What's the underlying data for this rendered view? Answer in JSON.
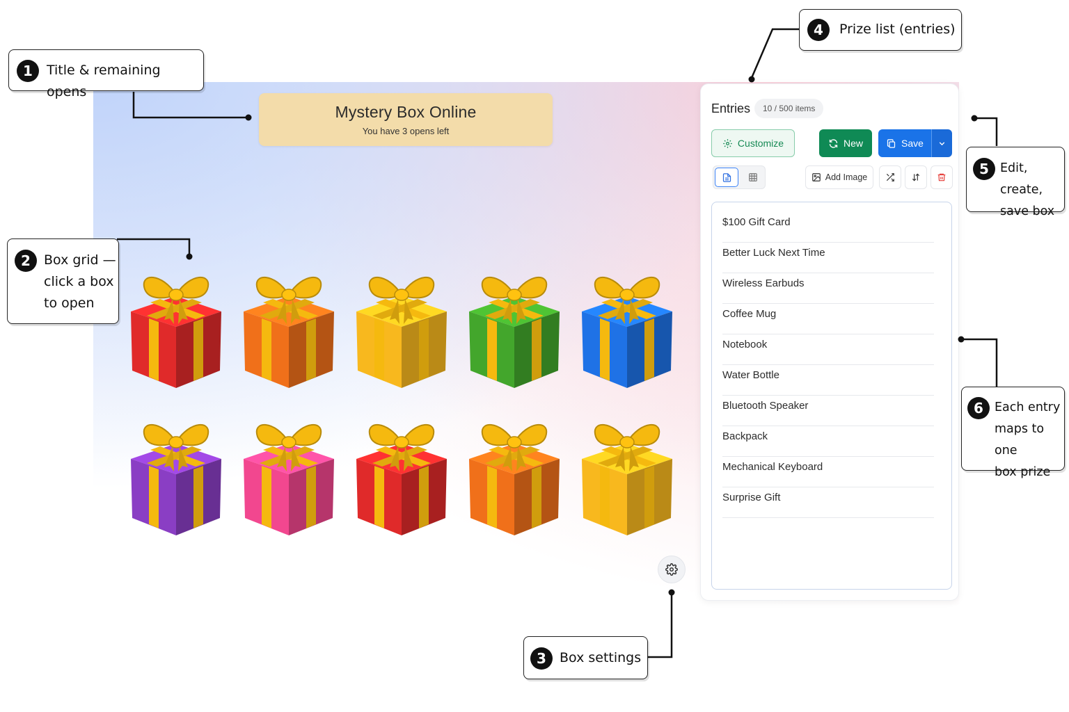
{
  "header": {
    "title": "Mystery Box Online",
    "subtitle": "You have 3 opens left"
  },
  "gift_boxes": [
    {
      "color": "#e02a2a"
    },
    {
      "color": "#f0701a"
    },
    {
      "color": "#f8b81e"
    },
    {
      "color": "#43a62c"
    },
    {
      "color": "#1f72e6"
    },
    {
      "color": "#8a3ec4"
    },
    {
      "color": "#f2478f"
    },
    {
      "color": "#e02a2a"
    },
    {
      "color": "#f0701a"
    },
    {
      "color": "#f8b81e"
    }
  ],
  "panel": {
    "title": "Entries",
    "count": "10 / 500 items",
    "customize_label": "Customize",
    "new_label": "New",
    "save_label": "Save",
    "add_image_label": "Add Image"
  },
  "entries": [
    "$100 Gift Card",
    "Better Luck Next Time",
    "Wireless Earbuds",
    "Coffee Mug",
    "Notebook",
    "Water Bottle",
    "Bluetooth Speaker",
    "Backpack",
    "Mechanical Keyboard",
    "Surprise Gift"
  ],
  "callouts": [
    {
      "number": "1",
      "lines": [
        "Title & remaining opens"
      ]
    },
    {
      "number": "2",
      "lines": [
        "Box grid —",
        "click a box",
        "to open"
      ]
    },
    {
      "number": "3",
      "lines": [
        "Box settings"
      ]
    },
    {
      "number": "4",
      "lines": [
        "Prize list (entries)"
      ]
    },
    {
      "number": "5",
      "lines": [
        "Edit, create,",
        "save box"
      ]
    },
    {
      "number": "6",
      "lines": [
        "Each entry",
        "maps to one",
        "box prize"
      ]
    }
  ],
  "colors": {
    "banner": "#f3dcaa",
    "new_button": "#0f8a55",
    "save_button": "#1a73e8",
    "customize_border": "#87ccaa",
    "ribbon": "#f5b90f"
  },
  "icons": {
    "customize": "gear-icon",
    "new": "refresh-icon",
    "save": "copy-icon",
    "save_menu": "chevron-down-icon",
    "list_view": "document-icon",
    "grid_view": "grid-icon",
    "add_image": "image-plus-icon",
    "shuffle": "shuffle-icon",
    "sort": "sort-icon",
    "delete": "trash-icon",
    "box_settings": "gear-icon"
  }
}
